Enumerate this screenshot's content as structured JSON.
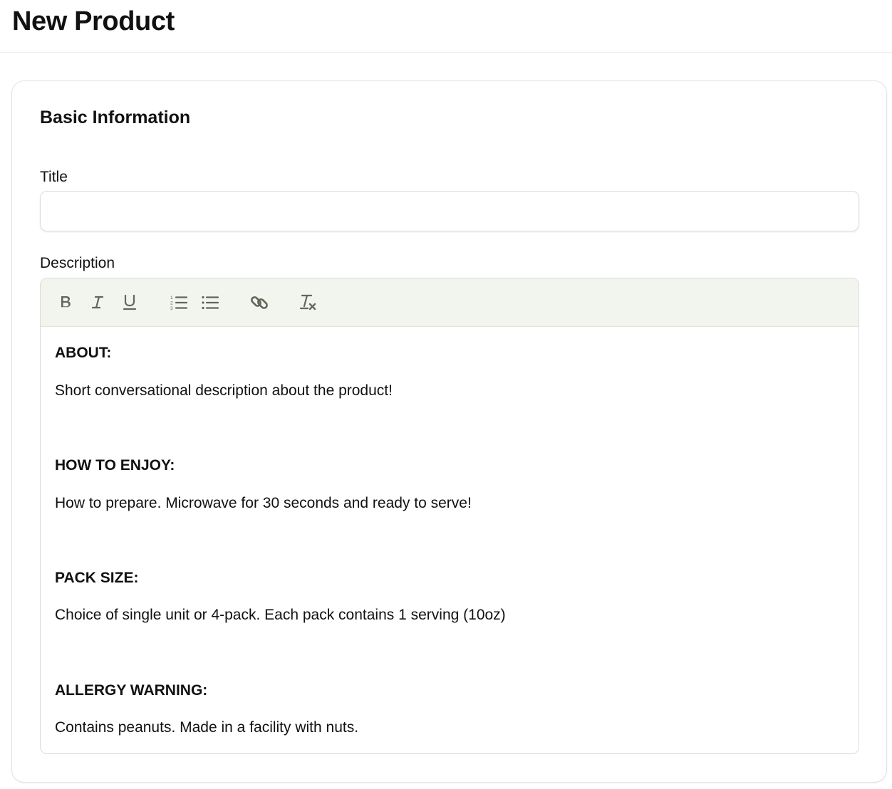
{
  "page": {
    "title": "New Product"
  },
  "section": {
    "title": "Basic Information"
  },
  "title_field": {
    "label": "Title",
    "value": "",
    "placeholder": ""
  },
  "description_field": {
    "label": "Description",
    "toolbar": [
      {
        "name": "bold-icon",
        "label": "B"
      },
      {
        "name": "italic-icon",
        "label": "I"
      },
      {
        "name": "underline-icon",
        "label": "U"
      },
      {
        "name": "ordered-list-icon",
        "label": ""
      },
      {
        "name": "bullet-list-icon",
        "label": ""
      },
      {
        "name": "link-icon",
        "label": ""
      },
      {
        "name": "clear-format-icon",
        "label": "T"
      }
    ],
    "blocks": [
      {
        "heading": "ABOUT:",
        "text": "Short conversational description about the product!"
      },
      {
        "heading": "HOW TO ENJOY:",
        "text": "How to prepare. Microwave for 30 seconds and ready to serve!"
      },
      {
        "heading": "PACK SIZE:",
        "text": "Choice of single unit or 4-pack. Each pack contains 1 serving (10oz)"
      },
      {
        "heading": "ALLERGY WARNING:",
        "text": "Contains peanuts. Made in a facility with nuts."
      }
    ]
  },
  "colors": {
    "toolbar_bg": "#f2f4ee",
    "icon": "#5f6858",
    "border": "#dcdcdc"
  }
}
